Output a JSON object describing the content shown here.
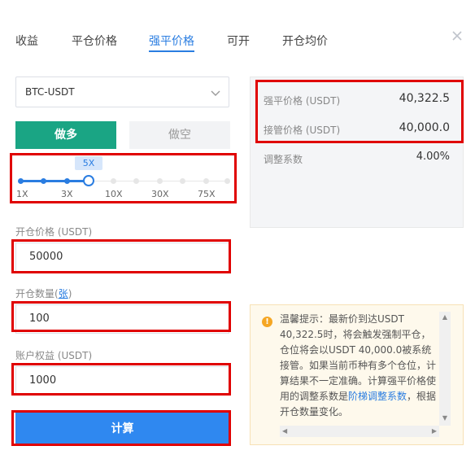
{
  "tabs": [
    {
      "label": "收益"
    },
    {
      "label": "平仓价格"
    },
    {
      "label": "强平价格"
    },
    {
      "label": "可开"
    },
    {
      "label": "开仓均价"
    }
  ],
  "active_tab": "强平价格",
  "pair_select": {
    "value": "BTC-USDT"
  },
  "side": {
    "long_label": "做多",
    "short_label": "做空",
    "selected": "做多"
  },
  "leverage": {
    "current": "5X",
    "marks": [
      "1X",
      "3X",
      "10X",
      "30X",
      "75X"
    ]
  },
  "form": {
    "open_price_label": "开仓价格 (USDT)",
    "open_price_value": "50000",
    "quantity_label_prefix": "开仓数量(",
    "quantity_unit": "张",
    "quantity_label_suffix": ")",
    "quantity_value": "100",
    "equity_label": "账户权益 (USDT)",
    "equity_value": "1000",
    "calculate_label": "计算"
  },
  "results": {
    "liq_price_label": "强平价格 (USDT)",
    "liq_price_value": "40,322.5",
    "takeover_price_label": "接管价格 (USDT)",
    "takeover_price_value": "40,000.0",
    "adjust_coef_label": "调整系数",
    "adjust_coef_value": "4.00%"
  },
  "tip": {
    "text_before_link": "温馨提示：最新价到达USDT 40,322.5时，将会触发强制平仓，仓位将会以USDT 40,000.0被系统接管。如果当前币种有多个仓位，计算结果不一定准确。计算强平价格使用的调整系数是",
    "link_text": "阶梯调整系数",
    "text_after_link": "，根据开仓数量变化。"
  },
  "colors": {
    "accent": "#2a7de1",
    "long_green": "#1aa584",
    "highlight_red": "#e00000",
    "tip_bg": "#fef9ec",
    "warning_orange": "#f5a623"
  },
  "icons": {
    "close": "close-icon",
    "select_chevron": "chevron-down-icon",
    "tip": "info-icon"
  }
}
